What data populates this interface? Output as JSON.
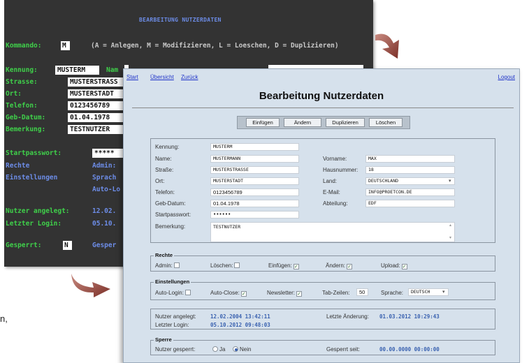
{
  "terminal": {
    "title": "BEARBEITUNG NUTZERDATEN",
    "kommando_label": "Kommando:",
    "kommando_value": "M",
    "kommando_hint_parts": [
      "(A = Anlegen, ",
      "M = Modifizieren, ",
      "L = Loeschen, ",
      "D = Duplizieren)"
    ],
    "fields": [
      {
        "label": "Kennung:",
        "value": "MUSTERM"
      },
      {
        "label": "Strasse:",
        "value": "MUSTERSTRASS"
      },
      {
        "label": "Ort:",
        "value": "MUSTERSTADT"
      },
      {
        "label": "Telefon:",
        "value": "0123456789"
      },
      {
        "label": "Geb-Datum:",
        "value": "01.04.1978"
      },
      {
        "label": "Bemerkung:",
        "value": "TESTNUTZER"
      }
    ],
    "name_label_partial": "Nam",
    "startpasswort_label": "Startpasswort:",
    "startpasswort_value": "*****",
    "rechte_label": "Rechte",
    "admin_partial": "Admin:",
    "einstellungen_label": "Einstellungen",
    "sprache_partial": "Sprach",
    "autolo_partial": "Auto-Lo",
    "angelegt_label": "Nutzer angelegt:",
    "angelegt_partial": "12.02.",
    "login_label": "Letzter Login:",
    "login_partial": "05.10.",
    "gesperrt_label": "Gesperrt:",
    "gesperrt_value": "N",
    "gesperr_partial": "Gesper"
  },
  "web": {
    "links": {
      "start": "Start",
      "uebersicht": "Übersicht",
      "zurueck": "Zurück",
      "logout": "Logout"
    },
    "title": "Bearbeitung Nutzerdaten",
    "buttons": {
      "einfuegen": "Einfügen",
      "aendern": "Ändern",
      "duplizieren": "Duplizieren",
      "loeschen": "Löschen"
    },
    "left_fields": [
      {
        "label": "Kennung:",
        "value": "MUSTERM"
      },
      {
        "label": "Name:",
        "value": "MUSTERMANN"
      },
      {
        "label": "Straße:",
        "value": "MUSTERSTRASSE"
      },
      {
        "label": "Ort:",
        "value": "MUSTERSTADT"
      },
      {
        "label": "Telefon:",
        "value": "0123456789"
      },
      {
        "label": "Geb-Datum:",
        "value": "01.04.1978"
      },
      {
        "label": "Startpasswort:",
        "value": "••••••"
      }
    ],
    "right_fields": [
      {
        "label": "Vorname:",
        "value": "MAX"
      },
      {
        "label": "Hausnummer:",
        "value": "18"
      },
      {
        "label": "Land:",
        "value": "DEUTSCHLAND"
      },
      {
        "label": "E-Mail:",
        "value": "INFO@PROETCON.DE"
      },
      {
        "label": "Abteilung:",
        "value": "EDF"
      }
    ],
    "bemerkung": {
      "label": "Bemerkung:",
      "value": "TESTNUTZER"
    },
    "rechte": {
      "legend": "Rechte",
      "items": [
        {
          "label": "Admin:",
          "checked": false
        },
        {
          "label": "Löschen:",
          "checked": false
        },
        {
          "label": "Einfügen:",
          "checked": true
        },
        {
          "label": "Ändern:",
          "checked": true
        },
        {
          "label": "Upload:",
          "checked": true
        }
      ]
    },
    "einstellungen": {
      "legend": "Einstellungen",
      "autologin": "Auto-Login:",
      "autoclose": "Auto-Close:",
      "newsletter": "Newsletter:",
      "tabzeilen_label": "Tab-Zeilen:",
      "tabzeilen_value": "50",
      "sprache_label": "Sprache:",
      "sprache_value": "DEUTSCH"
    },
    "info": {
      "angelegt_label": "Nutzer angelegt:",
      "angelegt_value": "12.02.2004 13:42:11",
      "login_label": "Letzter Login:",
      "login_value": "05.10.2012 09:48:03",
      "aenderung_label": "Letzte Änderung:",
      "aenderung_value": "01.03.2012 10:29:43"
    },
    "sperre": {
      "legend": "Sperre",
      "label": "Nutzer gesperrt:",
      "ja": "Ja",
      "nein": "Nein",
      "seit_label": "Gesperrt seit:",
      "seit_value": "00.00.0000 00:00:00"
    }
  },
  "colors": {
    "terminal_bg": "#333333",
    "terminal_green": "#3fd04a",
    "terminal_blue": "#6d8de8",
    "web_bg": "#d6e1ec",
    "link": "#2236c9",
    "value_blue": "#3a62b0",
    "arrow": "#8b3a30"
  },
  "leftover_text": "n,"
}
